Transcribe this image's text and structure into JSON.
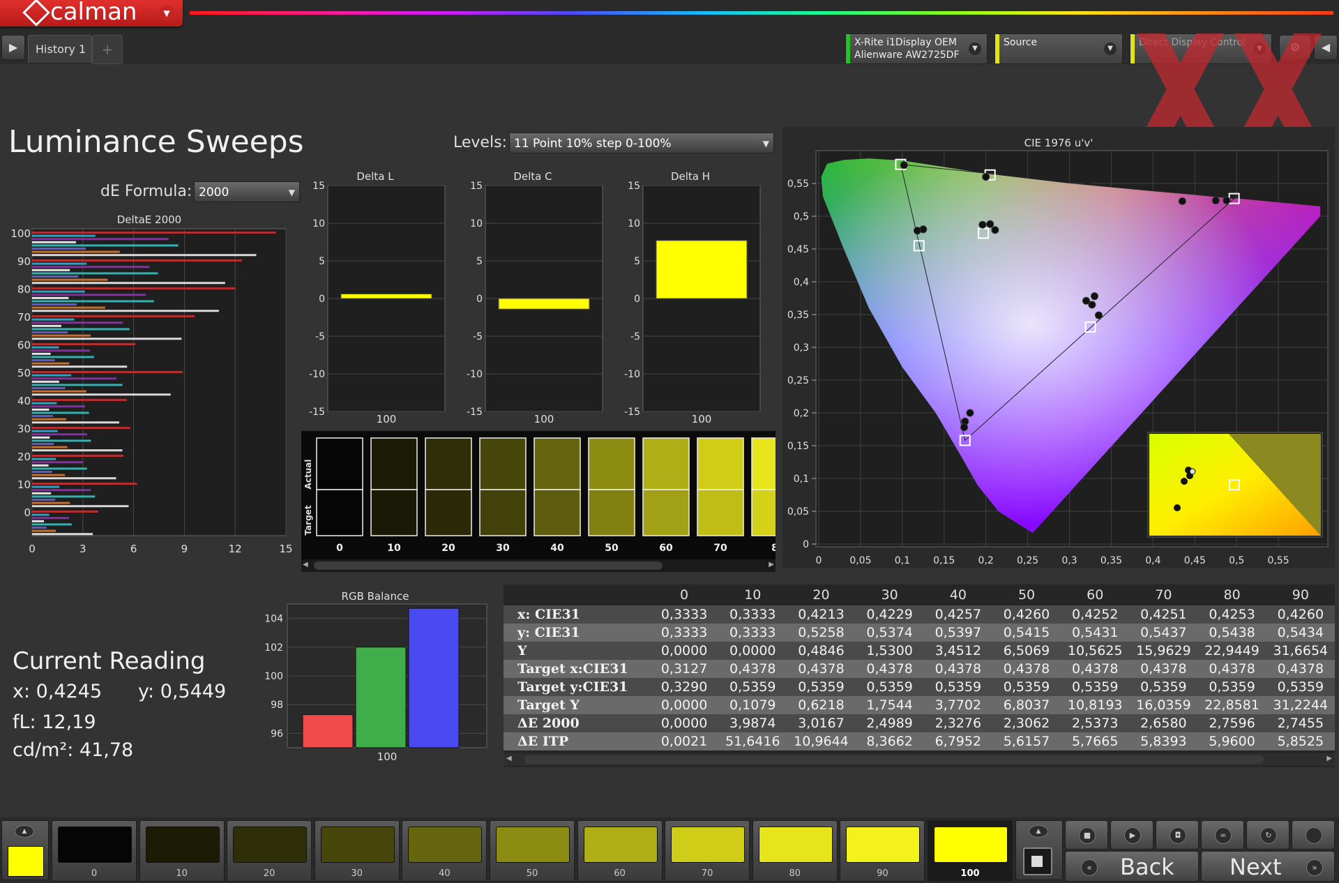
{
  "app": {
    "logo_text": "calman"
  },
  "tabs": [
    {
      "label": "History 1"
    }
  ],
  "tab_add_symbol": "+",
  "devices": {
    "meter": {
      "line1": "X-Rite i1Display OEM",
      "line2": "Alienware AW2725DF",
      "stripe": "#22c422"
    },
    "source": {
      "label": "Source",
      "stripe": "#e2e21a"
    },
    "ddc": {
      "label": "Direct Display Control",
      "stripe": "#e2e21a"
    }
  },
  "page_title": "Luminance Sweeps",
  "levels": {
    "label": "Levels:",
    "value": "11 Point 10% step 0-100%"
  },
  "formula": {
    "label": "dE Formula:",
    "value": "2000"
  },
  "charts": {
    "deltae": {
      "title": "DeltaE 2000",
      "yticks": [
        "100",
        "90",
        "80",
        "70",
        "60",
        "50",
        "40",
        "30",
        "20",
        "10",
        "0"
      ],
      "xticks": [
        "0",
        "3",
        "6",
        "9",
        "12",
        "15"
      ]
    },
    "delta_l": {
      "title": "Delta L",
      "yticks": [
        "15",
        "10",
        "5",
        "0",
        "-5",
        "-10",
        "-15"
      ],
      "category": "100"
    },
    "delta_c": {
      "title": "Delta C",
      "yticks": [
        "15",
        "10",
        "5",
        "0",
        "-5",
        "-10",
        "-15"
      ],
      "category": "100"
    },
    "delta_h": {
      "title": "Delta H",
      "yticks": [
        "15",
        "10",
        "5",
        "0",
        "-5",
        "-10",
        "-15"
      ],
      "category": "100"
    },
    "rgb": {
      "title": "RGB Balance",
      "yticks": [
        "104",
        "102",
        "100",
        "98",
        "96"
      ],
      "category": "100"
    },
    "cie": {
      "title": "CIE 1976 u'v'",
      "yticks": [
        "0,55",
        "0,5",
        "0,45",
        "0,4",
        "0,35",
        "0,3",
        "0,25",
        "0,2",
        "0,15",
        "0,1",
        "0,05",
        "0"
      ],
      "xticks": [
        "0",
        "0,05",
        "0,1",
        "0,15",
        "0,2",
        "0,25",
        "0,3",
        "0,35",
        "0,4",
        "0,45",
        "0,5",
        "0,55"
      ]
    }
  },
  "chart_data": [
    {
      "type": "bar",
      "title": "DeltaE 2000",
      "orientation": "horizontal",
      "categories": [
        "0",
        "10",
        "20",
        "30",
        "40",
        "50",
        "60",
        "70",
        "80",
        "90",
        "100"
      ],
      "xlim": [
        0,
        15
      ],
      "note_values_dense": true,
      "values_max_per_level": [
        3.9,
        6.2,
        5.4,
        5.8,
        5.6,
        8.9,
        6.1,
        9.6,
        12.0,
        12.4,
        14.4
      ]
    },
    {
      "type": "bar",
      "title": "Delta L",
      "categories": [
        "100"
      ],
      "values": [
        0.6
      ],
      "ylim": [
        -15,
        15
      ]
    },
    {
      "type": "bar",
      "title": "Delta C",
      "categories": [
        "100"
      ],
      "values": [
        -1.4
      ],
      "ylim": [
        -15,
        15
      ]
    },
    {
      "type": "bar",
      "title": "Delta H",
      "categories": [
        "100"
      ],
      "values": [
        7.7
      ],
      "ylim": [
        -15,
        15
      ]
    },
    {
      "type": "bar",
      "title": "RGB Balance",
      "categories": [
        "100"
      ],
      "series": [
        {
          "values": [
            97.3
          ],
          "color": "#f04a4a"
        },
        {
          "values": [
            102.0
          ],
          "color": "#3fae4a"
        },
        {
          "values": [
            104.7
          ],
          "color": "#4a4af2"
        }
      ],
      "ylim": [
        95,
        105
      ]
    },
    {
      "type": "scatter",
      "title": "CIE 1976 u'v'",
      "xlim": [
        0,
        0.6
      ],
      "ylim": [
        0,
        0.6
      ],
      "targets": [
        {
          "x": 0.098,
          "y": 0.579
        },
        {
          "x": 0.205,
          "y": 0.563
        },
        {
          "x": 0.497,
          "y": 0.527
        },
        {
          "x": 0.12,
          "y": 0.455
        },
        {
          "x": 0.197,
          "y": 0.474
        },
        {
          "x": 0.325,
          "y": 0.331
        },
        {
          "x": 0.175,
          "y": 0.158
        }
      ],
      "measured": [
        {
          "x": 0.102,
          "y": 0.578
        },
        {
          "x": 0.2,
          "y": 0.56
        },
        {
          "x": 0.435,
          "y": 0.523
        },
        {
          "x": 0.475,
          "y": 0.524
        },
        {
          "x": 0.488,
          "y": 0.524
        },
        {
          "x": 0.125,
          "y": 0.48
        },
        {
          "x": 0.118,
          "y": 0.478
        },
        {
          "x": 0.196,
          "y": 0.487
        },
        {
          "x": 0.205,
          "y": 0.488
        },
        {
          "x": 0.211,
          "y": 0.479
        },
        {
          "x": 0.33,
          "y": 0.378
        },
        {
          "x": 0.32,
          "y": 0.371
        },
        {
          "x": 0.327,
          "y": 0.365
        },
        {
          "x": 0.335,
          "y": 0.349
        },
        {
          "x": 0.181,
          "y": 0.2
        },
        {
          "x": 0.175,
          "y": 0.187
        },
        {
          "x": 0.174,
          "y": 0.178
        }
      ]
    }
  ],
  "swatches": [
    "0",
    "10",
    "20",
    "30",
    "40",
    "50",
    "60",
    "70",
    "8"
  ],
  "current_reading": {
    "title": "Current Reading",
    "x": "x: 0,4245",
    "y": "y: 0,5449",
    "fl": "fL: 12,19",
    "cdm2": "cd/m²: 41,78"
  },
  "table": {
    "columns": [
      "0",
      "10",
      "20",
      "30",
      "40",
      "50",
      "60",
      "70",
      "80",
      "90"
    ],
    "rows": [
      {
        "label": "x: CIE31",
        "values": [
          "0,3333",
          "0,3333",
          "0,4213",
          "0,4229",
          "0,4257",
          "0,4260",
          "0,4252",
          "0,4251",
          "0,4253",
          "0,4260"
        ]
      },
      {
        "label": "y: CIE31",
        "values": [
          "0,3333",
          "0,3333",
          "0,5258",
          "0,5374",
          "0,5397",
          "0,5415",
          "0,5431",
          "0,5437",
          "0,5438",
          "0,5434"
        ]
      },
      {
        "label": "Y",
        "values": [
          "0,0000",
          "0,0000",
          "0,4846",
          "1,5300",
          "3,4512",
          "6,5069",
          "10,5625",
          "15,9629",
          "22,9449",
          "31,6654"
        ]
      },
      {
        "label": "Target x:CIE31",
        "values": [
          "0,3127",
          "0,4378",
          "0,4378",
          "0,4378",
          "0,4378",
          "0,4378",
          "0,4378",
          "0,4378",
          "0,4378",
          "0,4378"
        ]
      },
      {
        "label": "Target y:CIE31",
        "values": [
          "0,3290",
          "0,5359",
          "0,5359",
          "0,5359",
          "0,5359",
          "0,5359",
          "0,5359",
          "0,5359",
          "0,5359",
          "0,5359"
        ]
      },
      {
        "label": "Target Y",
        "values": [
          "0,0000",
          "0,1079",
          "0,6218",
          "1,7544",
          "3,7702",
          "6,8037",
          "10,8193",
          "16,0359",
          "22,8581",
          "31,2244"
        ]
      },
      {
        "label": "ΔE 2000",
        "values": [
          "0,0000",
          "3,9874",
          "3,0167",
          "2,4989",
          "2,3276",
          "2,3062",
          "2,5373",
          "2,6580",
          "2,7596",
          "2,7455"
        ]
      },
      {
        "label": "ΔE ITP",
        "values": [
          "0,0021",
          "51,6416",
          "10,9644",
          "8,3662",
          "6,7952",
          "5,6157",
          "5,7665",
          "5,8393",
          "5,9600",
          "5,8525"
        ]
      }
    ]
  },
  "patches": [
    "0",
    "10",
    "20",
    "30",
    "40",
    "50",
    "60",
    "70",
    "80",
    "90",
    "100"
  ],
  "patch_colors": [
    "#050505",
    "#1b1b06",
    "#2e2e09",
    "#48470b",
    "#666510",
    "#8c8b12",
    "#b0ae16",
    "#cfcd18",
    "#e6e41a",
    "#f4f21c",
    "#ffff00"
  ],
  "active_patch": "100",
  "nav": {
    "back": "Back",
    "next": "Next",
    "back_chevron": "«",
    "next_chevron": "»"
  },
  "colors": {
    "yellow": "#ffff00",
    "panel_bg": "#2a2a2a"
  }
}
